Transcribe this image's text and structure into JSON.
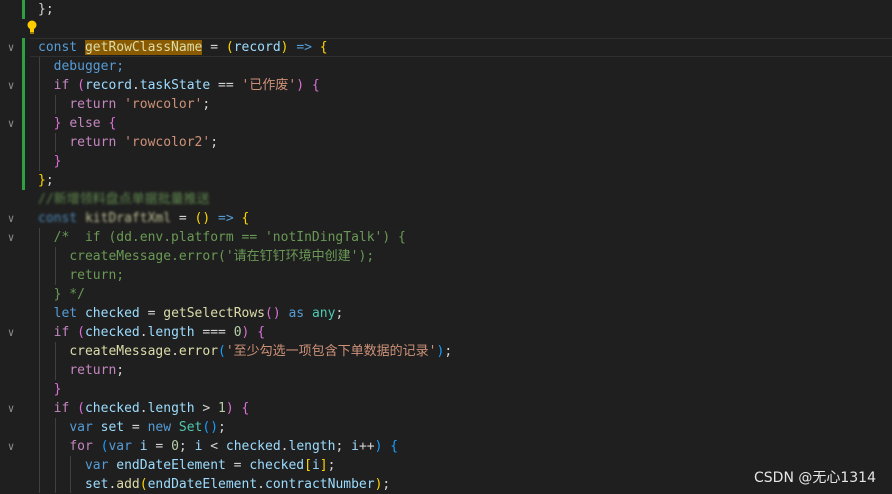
{
  "editor": {
    "language": "typescript",
    "lines": {
      "l01": "};",
      "l02_kw": "const",
      "l02_fn": "getRowClassName",
      "l02_param": "record",
      "l03": "debugger;",
      "l04_str": "'已作废'",
      "l05_str": "'rowcolor'",
      "l07_str": "'rowcolor2'",
      "l10_comment": "//新增领料盘点单据批量推送",
      "l11_name": "kitDraftXml",
      "l12_comment": "/*  if (dd.env.platform == 'notInDingTalk') {",
      "l13_comment": "createMessage.error('请在钉钉环境中创建');",
      "l14_comment": "return;",
      "l15_comment": "} */",
      "l16_fn": "getSelectRows",
      "l18_str": "'至少勾选一项包含下单数据的记录'",
      "l22_fn": "Set"
    }
  },
  "watermark": "CSDN @无心1314",
  "icons": [
    "lightbulb-icon",
    "fold-chevron-icon"
  ]
}
